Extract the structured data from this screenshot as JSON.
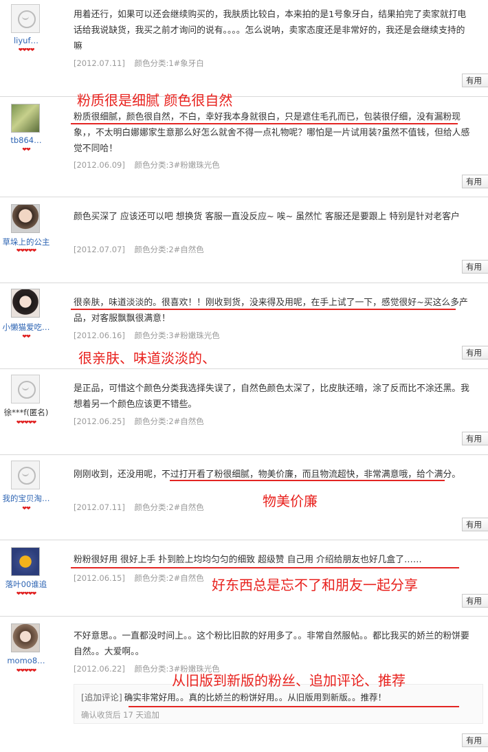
{
  "reviews": [
    {
      "user": "liyuf…",
      "rank": "❤❤❤❤",
      "content": "用着还行，如果可以还会继续购买的，我肤质比较白，本来拍的是1号象牙白，结果拍完了卖家就打电话给我说缺货，我买之前才询问的说有。。。。怎么说呐，卖家态度还是非常好的，我还是会继续支持的嘛",
      "date": "[2012.07.11]",
      "sku": "颜色分类:1#象牙白",
      "btn": "有用"
    },
    {
      "user": "tb864…",
      "rank": "❤❤",
      "content": "粉质很细腻，颜色很自然，不白，幸好我本身就很白，只是遮住毛孔而已，包装很仔细，没有漏粉现象，，不太明白娜娜家生意那么好怎么就舍不得一点礼物呢？哪怕是一片试用装?虽然不值钱，但给人感觉不同哈！",
      "date": "[2012.06.09]",
      "sku": "颜色分类:3#粉嫩珠光色",
      "btn": "有用"
    },
    {
      "user": "草垛上的公主",
      "rank": "❤❤❤❤❤",
      "content": "颜色买深了 应该还可以吧 想换货 客服一直没反应~ 唉~ 虽然忙 客服还是要跟上 特别是针对老客户",
      "date": "[2012.07.07]",
      "sku": "颜色分类:2#自然色",
      "btn": "有用"
    },
    {
      "user": "小懒猫爱吃…",
      "rank": "❤❤",
      "content": "很亲肤，味道淡淡的。很喜欢！！刚收到货，没来得及用呢，在手上试了一下，感觉很好~买这么多产品，对客服飘飘很满意！",
      "date": "[2012.06.16]",
      "sku": "颜色分类:3#粉嫩珠光色",
      "btn": "有用"
    },
    {
      "user": "徐***f(匿名)",
      "rank": "❤❤❤❤❤",
      "content": "是正品，可惜这个颜色分类我选择失误了，自然色颜色太深了，比皮肤还暗，涂了反而比不涂还黑。我想着另一个颜色应该更不错些。",
      "date": "[2012.06.25]",
      "sku": "颜色分类:2#自然色",
      "btn": "有用"
    },
    {
      "user": "我的宝贝淘…",
      "rank": "❤❤",
      "content": "刚刚收到，还没用呢，不过打开看了粉很细腻，物美价廉，而且物流超快，非常满意哦，给个满分。",
      "date": "[2012.07.11]",
      "sku": "颜色分类:2#自然色",
      "btn": "有用"
    },
    {
      "user": "落叶00谁追",
      "rank": "❤❤❤❤❤",
      "content": "粉粉很好用 很好上手 扑到脸上均均匀匀的细致 超级赞 自己用 介绍给朋友也好几盒了……",
      "date": "[2012.06.15]",
      "sku": "颜色分类:2#自然色",
      "btn": "有用"
    },
    {
      "user": "momo8…",
      "rank": "❤❤❤❤❤",
      "content": "不好意思。。一直都没时间上。。这个粉比旧款的好用多了。。非常自然服帖。。都比我买的娇兰的粉饼要自然。。大爱啊。。",
      "date": "[2012.06.22]",
      "sku": "颜色分类:3#粉嫩珠光色",
      "btn": "有用",
      "append": {
        "tag": "[追加评论]",
        "text": "确实非常好用。。真的比娇兰的粉饼好用。。从旧版用到新版。。推荐！",
        "note": "确认收货后 17 天追加"
      }
    }
  ],
  "annotations": {
    "a1": "粉质很是细腻 颜色很自然",
    "a2": "很亲肤、味道淡淡的、",
    "a3": "物美价廉",
    "a4": "好东西总是忘不了和朋友一起分享",
    "a5": "从旧版到新版的粉丝、追加评论、推荐"
  },
  "colors": {
    "accent": "#e8211d",
    "username": "#2d64b3",
    "meta": "#9a9a9a"
  },
  "icons": {
    "rank": "heart-diamond",
    "avatar_default": "taobao-default-avatar"
  }
}
